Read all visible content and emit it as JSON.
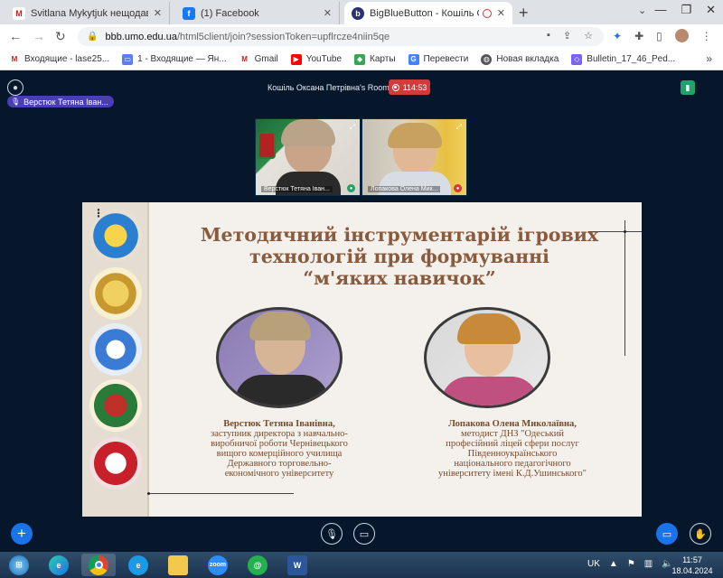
{
  "browser": {
    "tabs": [
      {
        "label": "Svitlana Mykytjuk нещодавно",
        "icon": "gmail-icon",
        "color": "#c5221f",
        "active": false
      },
      {
        "label": "(1) Facebook",
        "icon": "facebook-icon",
        "color": "#1877f2",
        "active": false
      },
      {
        "label": "BigBlueButton - Кошіль Оксана",
        "icon": "bigbluebutton-icon",
        "color": "#283274",
        "active": true
      }
    ],
    "url_host": "bbb.umo.edu.ua",
    "url_path": "/html5client/join?sessionToken=upflrcze4niin5qe",
    "bookmarks": [
      {
        "label": "Входящие - lase25...",
        "icon": "gmail-icon",
        "color": "#c5221f"
      },
      {
        "label": "1 - Входящие — Ян...",
        "icon": "yandex-mail-icon",
        "color": "#5c7cfa"
      },
      {
        "label": "Gmail",
        "icon": "gmail-icon",
        "color": "#c5221f"
      },
      {
        "label": "YouTube",
        "icon": "youtube-icon",
        "color": "#ff0000"
      },
      {
        "label": "Карты",
        "icon": "maps-icon",
        "color": "#34a853"
      },
      {
        "label": "Перевести",
        "icon": "translate-icon",
        "color": "#4285f4"
      },
      {
        "label": "Новая вкладка",
        "icon": "globe-icon",
        "color": "#555555"
      },
      {
        "label": "Bulletin_17_46_Ped...",
        "icon": "document-icon",
        "color": "#7b61ff"
      }
    ]
  },
  "meeting": {
    "speaker": "Верстюк Тетяна Іван...",
    "room_title": "Кошіль Оксана Петрівна's Room",
    "recording_time": "114:53",
    "webcams": [
      {
        "name": "Верстюк Тетяна Іван...",
        "mic": "on"
      },
      {
        "name": "Лопакова Олена Мик...",
        "mic": "muted"
      }
    ]
  },
  "slide": {
    "title_line1": "Методичний інструментарій ігрових",
    "title_line2": "технологій при формуванні",
    "title_line3": "“м'яких навичок”",
    "left_person": {
      "name": "Верстюк Тетяна Іванівна,",
      "line1": "заступник директора з навчально-",
      "line2": "виробничої роботи Чернівецького",
      "line3": "вищого комерційного училища",
      "line4": "Державного торговельно-",
      "line5": "економічного університету"
    },
    "right_person": {
      "name": "Лопакова Олена Миколаївна,",
      "line1": "методист ДНЗ \"Одеський",
      "line2": "професійний ліцей сфери послуг",
      "line3": "Південноукраїнського",
      "line4": "національного педагогічного",
      "line5": "університету імені К.Д.Ушинського\""
    }
  },
  "taskbar": {
    "lang": "UK",
    "time": "11:57",
    "date": "18.04.2024",
    "zoom_label": "zoom"
  }
}
